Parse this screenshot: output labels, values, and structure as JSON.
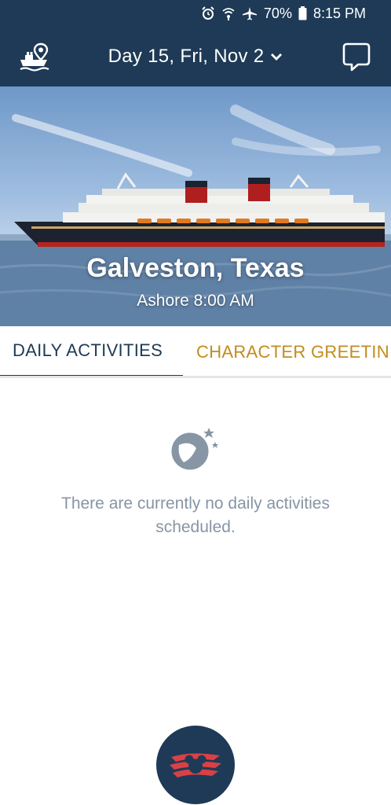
{
  "status_bar": {
    "battery": "70%",
    "time": "8:15 PM"
  },
  "header": {
    "date_label": "Day 15, Fri, Nov 2",
    "left_icon": "ship-map-icon",
    "right_icon": "chat-icon",
    "dropdown_icon": "chevron-down-icon"
  },
  "hero": {
    "port": "Galveston, Texas",
    "time": "Ashore 8:00 AM"
  },
  "tabs": [
    {
      "label": "DAILY ACTIVITIES",
      "active": true
    },
    {
      "label": "CHARACTER GREETIN",
      "active": false
    }
  ],
  "empty_state": {
    "icon": "beach-ball-icon",
    "message": "There are currently no daily activities scheduled."
  },
  "bottom_button": {
    "icon": "disney-cruise-logo-icon"
  },
  "colors": {
    "navy": "#1e3a56",
    "gold": "#c28c1d",
    "muted_text": "#8795a5"
  }
}
